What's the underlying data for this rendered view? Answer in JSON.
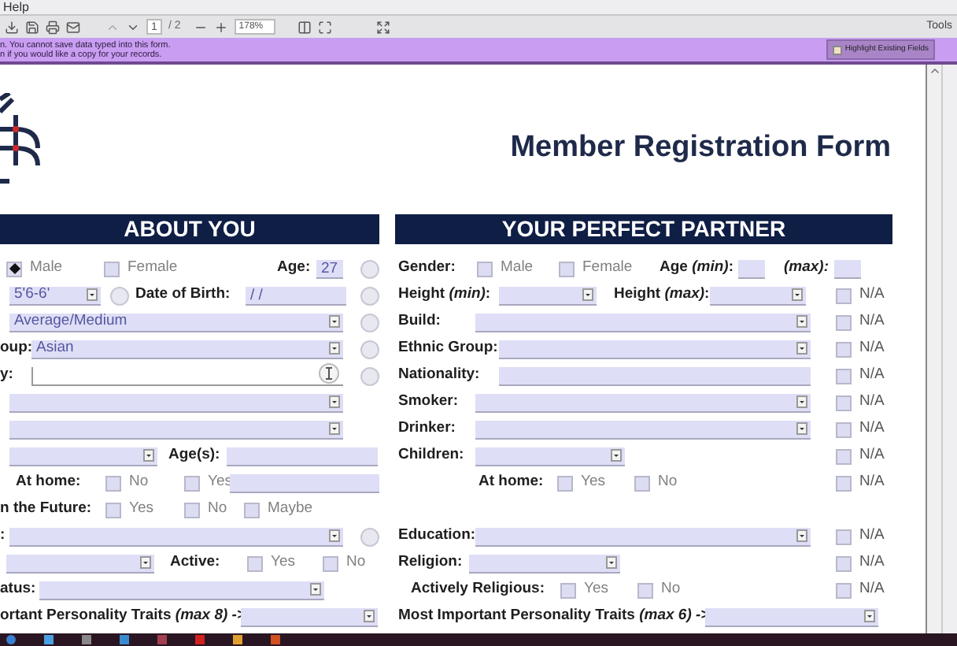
{
  "menu": [
    "Help"
  ],
  "toolbar": {
    "page": "1",
    "page_count": "/ 2",
    "zoom": "178%",
    "tools": "Tools"
  },
  "notice": {
    "lines": [
      "n. You cannot save data typed into this form.",
      "n if you would like a copy for your records."
    ],
    "button": "Highlight Existing Fields"
  },
  "form": {
    "title": "Member Registration Form",
    "about_you": {
      "heading": "ABOUT YOU",
      "rows": [
        {
          "items": [
            {
              "kind": "checkbox",
              "label": "Male",
              "checked": true
            },
            {
              "kind": "checkbox",
              "label": "Female",
              "checked": false
            },
            {
              "kind": "label",
              "text": "Age:"
            },
            {
              "kind": "field",
              "value": "27",
              "focused": false
            }
          ],
          "round": {
            "checked": false
          }
        },
        {
          "items": [
            {
              "kind": "dropdown",
              "value": "5'6-6'"
            },
            {
              "kind": "circle",
              "checked": false
            },
            {
              "kind": "label",
              "text": "Date of Birth:"
            },
            {
              "kind": "field",
              "value": "/   /",
              "focused": false
            }
          ],
          "round": {
            "checked": false
          }
        },
        {
          "items": [
            {
              "kind": "dropdown",
              "value": "Average/Medium"
            }
          ],
          "round": {
            "checked": false
          }
        },
        {
          "items": [
            {
              "kind": "label",
              "text": "oup:"
            },
            {
              "kind": "dropdown",
              "value": "Asian"
            }
          ],
          "round": {
            "checked": false
          }
        },
        {
          "items": [
            {
              "kind": "label",
              "text": "y:"
            },
            {
              "kind": "field",
              "focused": true
            }
          ],
          "round": {
            "checked": false
          }
        },
        {
          "items": [
            {
              "kind": "dropdown"
            }
          ]
        },
        {
          "items": [
            {
              "kind": "dropdown"
            }
          ]
        },
        {
          "items": [
            {
              "kind": "dropdown"
            },
            {
              "kind": "label",
              "text": "Age(s):"
            },
            {
              "kind": "field",
              "focused": false
            }
          ]
        },
        {
          "items": [
            {
              "kind": "label",
              "text": "At home:"
            },
            {
              "kind": "checkbox",
              "label": "No",
              "checked": false
            },
            {
              "kind": "checkbox",
              "label": "Yes",
              "checked": false
            },
            {
              "kind": "field",
              "focused": false
            }
          ]
        },
        {
          "items": [
            {
              "kind": "label",
              "text": "n the Future:"
            },
            {
              "kind": "checkbox",
              "label": "Yes",
              "checked": false
            },
            {
              "kind": "checkbox",
              "label": "No",
              "checked": false
            },
            {
              "kind": "checkbox",
              "label": "Maybe",
              "checked": false
            }
          ]
        },
        {
          "items": [
            {
              "kind": "label",
              "text": ":"
            },
            {
              "kind": "dropdown"
            }
          ],
          "round": {
            "checked": false
          }
        },
        {
          "items": [
            {
              "kind": "dropdown"
            },
            {
              "kind": "label",
              "text": "Active:"
            },
            {
              "kind": "checkbox",
              "label": "Yes",
              "checked": false
            },
            {
              "kind": "checkbox",
              "label": "No",
              "checked": false
            }
          ]
        },
        {
          "items": [
            {
              "kind": "label",
              "text": "atus:"
            },
            {
              "kind": "dropdown"
            }
          ]
        },
        {
          "items": [
            {
              "kind": "label",
              "text": "ortant Personality Traits *(max 8) ->*"
            },
            {
              "kind": "dropdown"
            }
          ]
        }
      ]
    },
    "partner": {
      "heading": "YOUR PERFECT PARTNER",
      "rows": [
        {
          "items": [
            {
              "kind": "label",
              "text": "Gender:"
            },
            {
              "kind": "checkbox",
              "label": "Male",
              "checked": false
            },
            {
              "kind": "checkbox",
              "label": "Female",
              "checked": false
            },
            {
              "kind": "label",
              "text": "Age *(min)*:"
            },
            {
              "kind": "field",
              "focused": false
            },
            {
              "kind": "label",
              "text": "*(max):*"
            },
            {
              "kind": "field",
              "focused": false
            }
          ]
        },
        {
          "items": [
            {
              "kind": "label",
              "text": "Height *(min)*:"
            },
            {
              "kind": "dropdown"
            },
            {
              "kind": "label",
              "text": "Height *(max)*:"
            },
            {
              "kind": "dropdown"
            }
          ],
          "na": {
            "label": "N/A",
            "checked": false
          }
        },
        {
          "items": [
            {
              "kind": "label",
              "text": "Build:"
            },
            {
              "kind": "dropdown"
            }
          ],
          "na": {
            "label": "N/A",
            "checked": false
          }
        },
        {
          "items": [
            {
              "kind": "label",
              "text": "Ethnic Group:"
            },
            {
              "kind": "dropdown"
            }
          ],
          "na": {
            "label": "N/A",
            "checked": false
          }
        },
        {
          "items": [
            {
              "kind": "label",
              "text": "Nationality:"
            },
            {
              "kind": "field",
              "focused": false
            }
          ],
          "na": {
            "label": "N/A",
            "checked": false
          }
        },
        {
          "items": [
            {
              "kind": "label",
              "text": "Smoker:"
            },
            {
              "kind": "dropdown"
            }
          ],
          "na": {
            "label": "N/A",
            "checked": false
          }
        },
        {
          "items": [
            {
              "kind": "label",
              "text": "Drinker:"
            },
            {
              "kind": "dropdown"
            }
          ],
          "na": {
            "label": "N/A",
            "checked": false
          }
        },
        {
          "items": [
            {
              "kind": "label",
              "text": "Children:"
            },
            {
              "kind": "dropdown"
            }
          ],
          "na": {
            "label": "N/A",
            "checked": false
          }
        },
        {
          "items": [
            {
              "kind": "label",
              "text": "At home:"
            },
            {
              "kind": "checkbox",
              "label": "Yes",
              "checked": false
            },
            {
              "kind": "checkbox",
              "label": "No",
              "checked": false
            }
          ],
          "na": {
            "label": "N/A",
            "checked": false
          }
        },
        {
          "items": [
            {
              "kind": "label",
              "text": "Education:"
            },
            {
              "kind": "dropdown"
            }
          ],
          "na": {
            "label": "N/A",
            "checked": false
          }
        },
        {
          "items": [
            {
              "kind": "label",
              "text": "Religion:"
            },
            {
              "kind": "dropdown"
            }
          ],
          "na": {
            "label": "N/A",
            "checked": false
          }
        },
        {
          "items": [
            {
              "kind": "label",
              "text": "Actively Religious:"
            },
            {
              "kind": "checkbox",
              "label": "Yes",
              "checked": false
            },
            {
              "kind": "checkbox",
              "label": "No",
              "checked": false
            }
          ],
          "na": {
            "label": "N/A",
            "checked": false
          }
        },
        {
          "items": [
            {
              "kind": "label",
              "text": "Most Important Personality Traits *(max 6) ->*"
            },
            {
              "kind": "dropdown"
            }
          ]
        }
      ]
    }
  }
}
